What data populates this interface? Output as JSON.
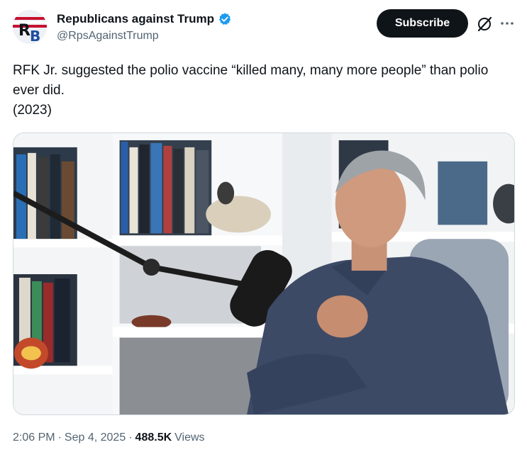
{
  "author": {
    "display_name": "Republicans against Trump",
    "handle": "@RpsAgainstTrump",
    "avatar_letters": "RB",
    "verified": true
  },
  "actions": {
    "subscribe_label": "Subscribe",
    "grok_icon": "grok-icon",
    "more_icon": "more-icon"
  },
  "tweet": {
    "text": "RFK Jr. suggested the polio vaccine “killed many, many more people” than polio ever did.\n(2023)"
  },
  "media": {
    "type": "video-still"
  },
  "meta": {
    "time": "2:06 PM",
    "separator": "·",
    "date": "Sep 4, 2025",
    "views_count": "488.5K",
    "views_label": "Views"
  },
  "colors": {
    "verified": "#1d9bf0",
    "text_primary": "#0f1419",
    "text_secondary": "#536471",
    "button_bg": "#0f1419"
  }
}
